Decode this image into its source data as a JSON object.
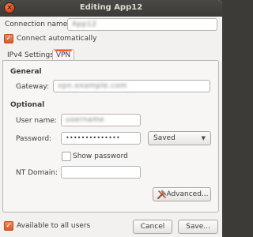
{
  "window": {
    "title": "Editing App12",
    "close_icon": "close-icon"
  },
  "connection": {
    "name_label": "Connection name:",
    "name_value": "App12",
    "connect_auto_label": "Connect automatically",
    "connect_auto_checked": true
  },
  "tabs": [
    {
      "label": "IPv4 Settings",
      "active": false
    },
    {
      "label": "VPN",
      "active": true
    }
  ],
  "general": {
    "heading": "General",
    "gateway_label": "Gateway:",
    "gateway_value": "vpn.example.com"
  },
  "optional": {
    "heading": "Optional",
    "username_label": "User name:",
    "username_value": "username",
    "password_label": "Password:",
    "password_value": "••••••••••••••",
    "password_storage": "Saved",
    "show_password_label": "Show password",
    "show_password_checked": false,
    "nt_domain_label": "NT Domain:",
    "nt_domain_value": ""
  },
  "advanced_button": "Advanced...",
  "footer": {
    "all_users_label": "Available to all users",
    "all_users_checked": true,
    "cancel_label": "Cancel",
    "save_label": "Save..."
  },
  "colors": {
    "accent": "#e5602a",
    "titlebar": "#3c3b37",
    "background": "#f2f1f0"
  }
}
